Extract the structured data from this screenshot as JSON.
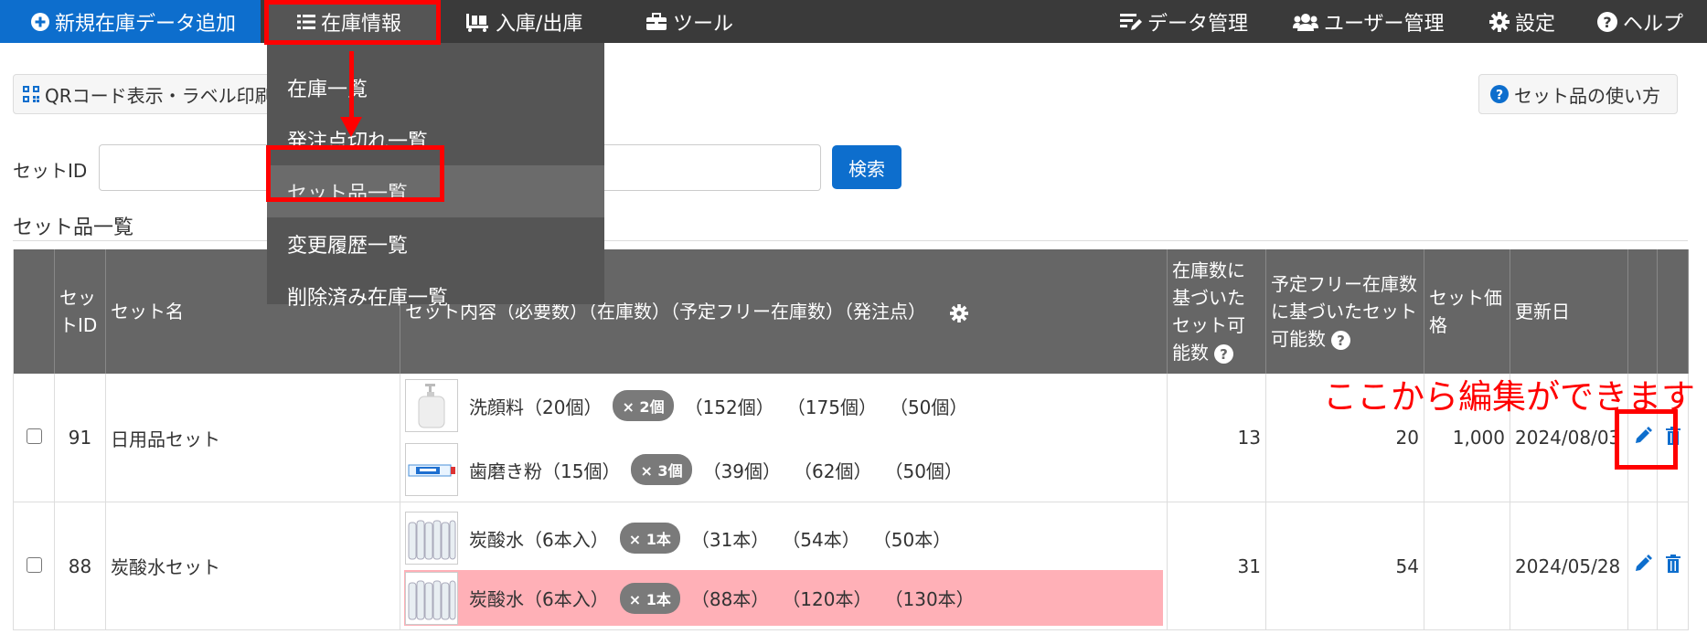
{
  "nav": {
    "add_new": "新規在庫データ追加",
    "stock_info": "在庫情報",
    "in_out": "入庫/出庫",
    "tools": "ツール",
    "data_mgmt": "データ管理",
    "user_mgmt": "ユーザー管理",
    "settings": "設定",
    "help": "ヘルプ"
  },
  "dropdown": {
    "items": [
      {
        "label": "在庫一覧"
      },
      {
        "label": "発注点切れ一覧"
      },
      {
        "label": "セット品一覧"
      },
      {
        "label": "変更履歴一覧"
      },
      {
        "label": "削除済み在庫一覧"
      }
    ]
  },
  "toolbar": {
    "qr_label": "QRコード表示・ラベル印刷",
    "howto_label": "セット品の使い方"
  },
  "search": {
    "label": "セットID",
    "value": "",
    "button": "検索"
  },
  "section_title": "セット品一覧",
  "table": {
    "headers": {
      "id": "セットID",
      "name": "セット名",
      "contents": "セット内容（必要数）（在庫数）（予定フリー在庫数）（発注点）",
      "possible_stock": "在庫数に基づいたセット可能数",
      "possible_free": "予定フリー在庫数に基づいたセット可能数",
      "price": "セット価格",
      "updated": "更新日"
    },
    "rows": [
      {
        "id": "91",
        "name": "日用品セット",
        "components": [
          {
            "name": "洗顔料（20個）",
            "qty": "× 2個",
            "stock": "（152個）",
            "free": "（175個）",
            "reorder": "（50個）"
          },
          {
            "name": "歯磨き粉（15個）",
            "qty": "× 3個",
            "stock": "（39個）",
            "free": "（62個）",
            "reorder": "（50個）"
          }
        ],
        "possible_stock": "13",
        "possible_free": "20",
        "price": "1,000",
        "updated": "2024/08/03"
      },
      {
        "id": "88",
        "name": "炭酸水セット",
        "components": [
          {
            "name": "炭酸水（6本入）",
            "qty": "× 1本",
            "stock": "（31本）",
            "free": "（54本）",
            "reorder": "（50本）"
          },
          {
            "name": "炭酸水（6本入）",
            "qty": "× 1本",
            "stock": "（88本）",
            "free": "（120本）",
            "reorder": "（130本）"
          }
        ],
        "possible_stock": "31",
        "possible_free": "54",
        "price": "",
        "updated": "2024/05/28"
      }
    ]
  },
  "annotation": {
    "text": "ここから編集ができます"
  },
  "colors": {
    "nav_bg": "#3a3a3a",
    "primary": "#0d6ecd",
    "dropdown_bg": "#555555",
    "table_header": "#666666",
    "alert_row": "#ffb0b7",
    "annotation": "#ff0000"
  }
}
